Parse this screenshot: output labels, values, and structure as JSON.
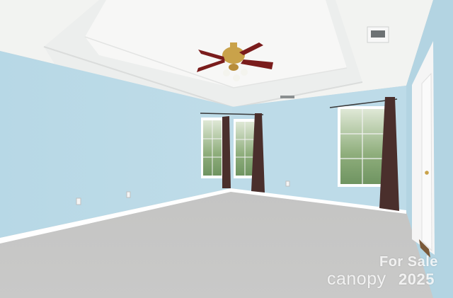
{
  "scene": {
    "description_label": "Empty carpeted room with tray ceiling, ceiling fan, three curtained windows and a white door",
    "colors": {
      "wall": "#bcdbe8",
      "wall_shadow": "#a9ccdb",
      "ceiling": "#f4f5f3",
      "carpet": "#c7c7c6",
      "trim": "#ffffff",
      "curtain": "#4a2f2c",
      "fan_blade": "#7a1c1c",
      "fan_brass": "#c9a24a"
    },
    "icons": [
      "ceiling-fan-icon",
      "air-vent-icon",
      "door-hinge-icon"
    ]
  },
  "watermark": {
    "line1": "For Sale",
    "brand": "canopy",
    "year": "2025"
  }
}
